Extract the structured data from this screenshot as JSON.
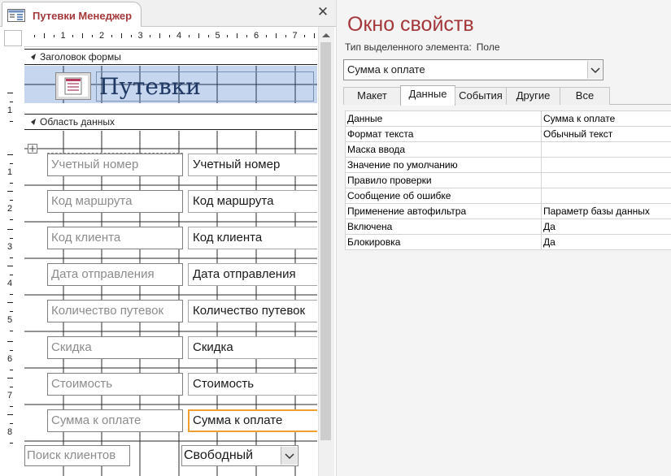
{
  "document": {
    "tab_label": "Путевки Менеджер",
    "close_glyph": "✕",
    "tab_icon": "form-icon"
  },
  "ruler": {
    "h_numbers": [
      "1",
      "2",
      "3",
      "4",
      "5",
      "6",
      "7"
    ],
    "v_numbers": [
      "1",
      "1",
      "2",
      "3",
      "4",
      "5",
      "6",
      "7",
      "8"
    ]
  },
  "form": {
    "header_section_label": "Заголовок формы",
    "detail_section_label": "Область данных",
    "title": "Путевки",
    "logo_icon": "form-logo-icon",
    "fields": [
      {
        "label": "Учетный номер",
        "value": "Учетный номер"
      },
      {
        "label": "Код маршрута",
        "value": "Код маршрута"
      },
      {
        "label": "Код клиента",
        "value": "Код клиента"
      },
      {
        "label": "Дата отправления",
        "value": "Дата отправления"
      },
      {
        "label": "Количество путевок",
        "value": "Количество путевок"
      },
      {
        "label": "Скидка",
        "value": "Скидка"
      },
      {
        "label": "Стоимость",
        "value": "Стоимость"
      },
      {
        "label": "Сумма к оплате",
        "value": "Сумма к оплате"
      }
    ],
    "search_label": "Поиск клиентов",
    "search_combo_value": "Свободный"
  },
  "property_sheet": {
    "title": "Окно свойств",
    "selection_type_label": "Тип выделенного элемента:",
    "selection_type_value": "Поле",
    "selected_object": "Сумма к оплате",
    "tabs": [
      {
        "label": "Макет",
        "active": false
      },
      {
        "label": "Данные",
        "active": true
      },
      {
        "label": "События",
        "active": false
      },
      {
        "label": "Другие",
        "active": false
      },
      {
        "label": "Все",
        "active": false
      }
    ],
    "properties": [
      {
        "name": "Данные",
        "value": "Сумма к оплате"
      },
      {
        "name": "Формат текста",
        "value": "Обычный текст"
      },
      {
        "name": "Маска ввода",
        "value": ""
      },
      {
        "name": "Значение по умолчанию",
        "value": ""
      },
      {
        "name": "Правило проверки",
        "value": ""
      },
      {
        "name": "Сообщение об ошибке",
        "value": ""
      },
      {
        "name": "Применение автофильтра",
        "value": "Параметр базы данных"
      },
      {
        "name": "Включена",
        "value": "Да"
      },
      {
        "name": "Блокировка",
        "value": "Да"
      }
    ]
  },
  "colors": {
    "accent": "#a4373a",
    "header_band": "#c5d6ee",
    "selection": "#f0a030"
  }
}
